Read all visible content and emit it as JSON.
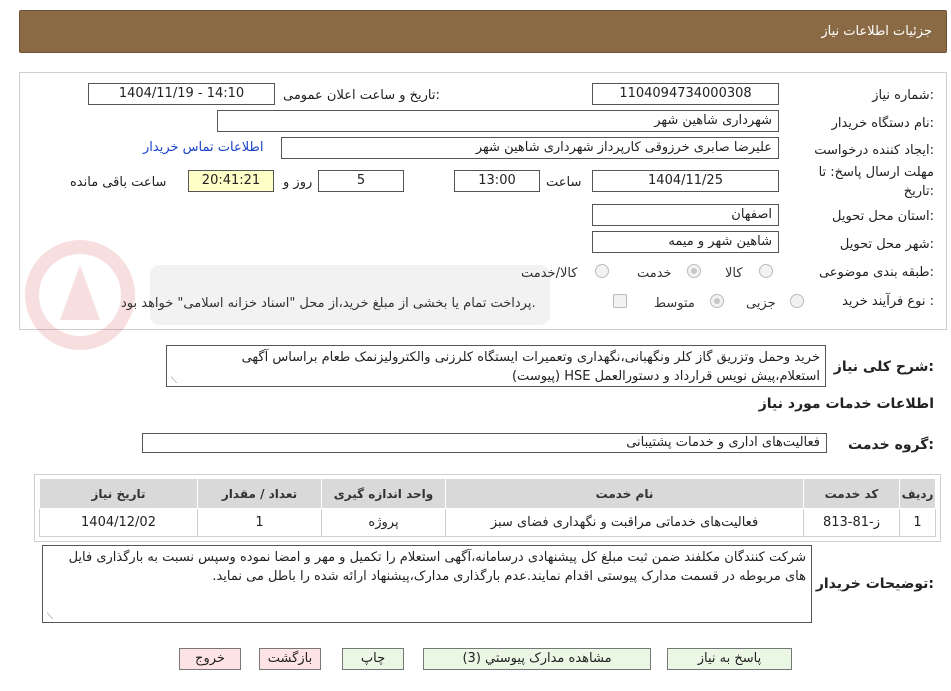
{
  "window": {
    "title": "جزئیات اطلاعات نیاز"
  },
  "form": {
    "need_number_label": "شماره نیاز:",
    "need_number": "1104094734000308",
    "announce_label": "تاریخ و ساعت اعلان عمومی:",
    "announce_value": "1404/11/19 - 14:10",
    "buyer_org_label": "نام دستگاه خریدار:",
    "buyer_org": "شهرداری شاهین شهر",
    "creator_label": "ایجاد کننده درخواست:",
    "creator": "علیرضا صابری خرزوقی کارپرداز شهرداری شاهین شهر",
    "contact_link": "اطلاعات تماس خریدار",
    "deadline_label_1": "مهلت ارسال پاسخ: تا",
    "deadline_label_2": "تاریخ:",
    "deadline_date": "1404/11/25",
    "time_label": "ساعت",
    "deadline_time": "13:00",
    "days_value": "5",
    "days_label": "روز و",
    "remaining_time": "20:41:21",
    "remaining_label": "ساعت باقی مانده",
    "province_label": "استان محل تحویل:",
    "province": "اصفهان",
    "city_label": "شهر محل تحویل:",
    "city": "شاهین شهر و میمه",
    "category_label": "طبقه بندی موضوعی:",
    "category_options": [
      "کالا",
      "خدمت",
      "کالا/خدمت"
    ],
    "category_selected": "خدمت",
    "process_label": "نوع فرآیند خرید :",
    "process_options": [
      "جزیی",
      "متوسط"
    ],
    "process_selected": "متوسط",
    "payment_note": "پرداخت تمام یا بخشی از مبلغ خرید،از محل \"اسناد خزانه اسلامی\" خواهد بود."
  },
  "description": {
    "label": "شرح کلی نیاز:",
    "text": "خرید وحمل وتزریق گاز کلر ونگهبانی،نگهداری وتعمیرات ایستگاه کلرزنی والکترولیزنمک طعام براساس آگهی استعلام،پیش نویس قرارداد و دستورالعمل HSE (پیوست)"
  },
  "services": {
    "title": "اطلاعات خدمات مورد نیاز",
    "group_label": "گروه خدمت:",
    "group_value": "فعالیت‌های اداری و خدمات پشتیبانی",
    "headers": [
      "ردیف",
      "کد خدمت",
      "نام خدمت",
      "واحد اندازه گیری",
      "تعداد / مقدار",
      "تاریخ نیاز"
    ],
    "rows": [
      [
        "1",
        "ز-81-813",
        "فعالیت‌های خدماتی مراقبت و نگهداری فضای سبز",
        "پروژه",
        "1",
        "1404/12/02"
      ]
    ]
  },
  "buyer_notes": {
    "label": "توضیحات خریدار:",
    "text": "شرکت کنندگان مکلفند ضمن ثبت مبلغ کل پیشنهادی درسامانه،آگهی استعلام را  تکمیل و مهر و امضا نموده وسپس نسبت به بارگذاری فایل های مربوطه در قسمت مدارک پیوستی اقدام نمایند.عدم بارگذاری مدارک،پیشنهاد ارائه شده را باطل می نماید."
  },
  "buttons": {
    "reply": "پاسخ به نیاز",
    "attachments": "مشاهده مدارک پیوستي (3)",
    "print": "چاپ",
    "back": "بازگشت",
    "exit": "خروج"
  },
  "colors": {
    "title_bar": "#8a6a45",
    "link": "#1a44c9",
    "remaining_bg": "#ffffc8"
  }
}
